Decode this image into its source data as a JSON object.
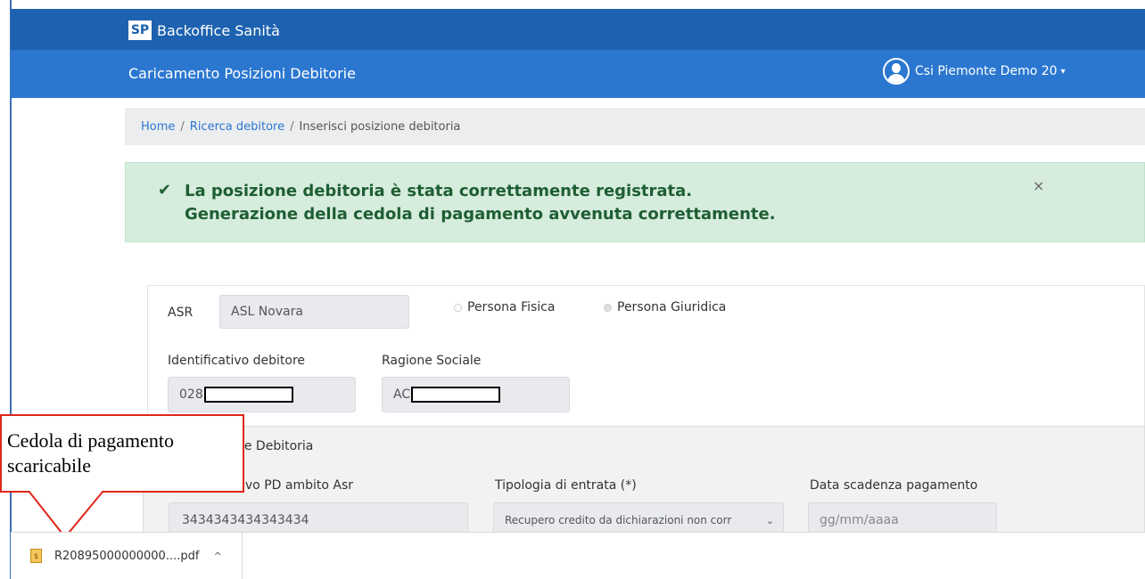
{
  "header": {
    "logo_text": "SP",
    "app_name": "Backoffice Sanità",
    "page_title": "Caricamento Posizioni Debitorie",
    "user_name": "Csi Piemonte Demo 20",
    "user_caret": "▾"
  },
  "breadcrumb": {
    "items": [
      "Home",
      "Ricerca debitore",
      "Inserisci posizione debitoria"
    ],
    "separator": "/"
  },
  "alert": {
    "check": "✔",
    "line1": "La posizione debitoria è stata correttamente registrata.",
    "line2": "Generazione della cedola di pagamento avvenuta correttamente.",
    "close": "×"
  },
  "form": {
    "asr_label": "ASR",
    "asr_value": "ASL Novara",
    "radio_fisica": "Persona Fisica",
    "radio_giuridica": "Persona Giuridica",
    "id_debitore_label": "Identificativo debitore",
    "id_debitore_value": "028",
    "ragione_sociale_label": "Ragione Sociale",
    "ragione_sociale_value": "AC"
  },
  "section": {
    "title": "ne Debitoria",
    "identificativo_label": "ivo PD ambito Asr",
    "identificativo_value": "3434343434343434",
    "tipologia_label": "Tipologia di entrata (*)",
    "tipologia_value": "Recupero credito da dichiarazioni non corr",
    "data_scadenza_label": "Data scadenza pagamento",
    "data_scadenza_placeholder": "gg/mm/aaaa"
  },
  "callout": {
    "line1": "Cedola di pagamento",
    "line2": "scaricabile",
    "border_color": "#e0261b"
  },
  "download": {
    "file_name": "R20895000000000....pdf",
    "icon_glyph": "$",
    "caret": "^"
  },
  "colors": {
    "topbar": "#1d62b0",
    "subbar": "#2b77d0",
    "alert_bg": "#d6ecdd",
    "alert_text": "#1e5e33"
  }
}
